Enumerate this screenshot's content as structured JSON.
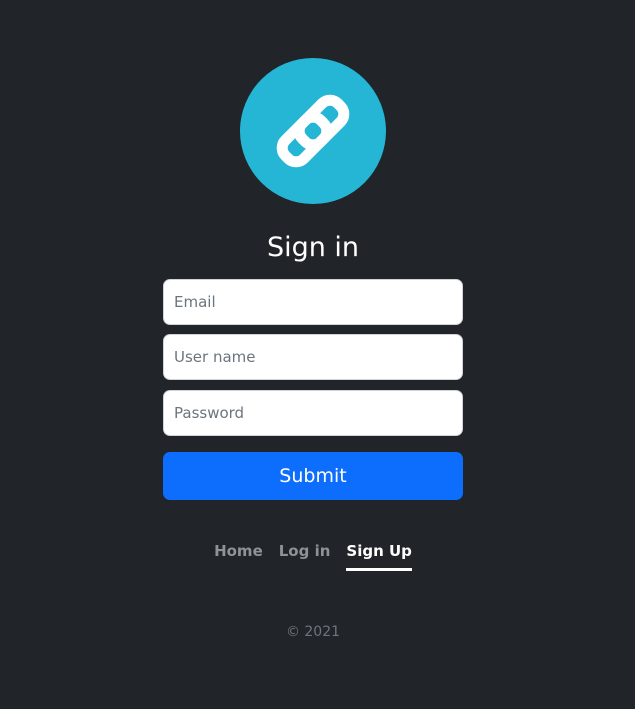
{
  "logo": {
    "icon": "link-icon",
    "color": "#25b6d6"
  },
  "page": {
    "title": "Sign in"
  },
  "form": {
    "email_placeholder": "Email",
    "username_placeholder": "User name",
    "password_placeholder": "Password",
    "submit_label": "Submit"
  },
  "nav": {
    "items": [
      {
        "label": "Home",
        "active": false
      },
      {
        "label": "Log in",
        "active": false
      },
      {
        "label": "Sign Up",
        "active": true
      }
    ]
  },
  "footer": {
    "text": "© 2021"
  },
  "colors": {
    "background": "#212529",
    "primary": "#0d6efd",
    "logo": "#25b6d6",
    "nav_inactive": "#8f9296",
    "nav_active": "#ffffff"
  }
}
